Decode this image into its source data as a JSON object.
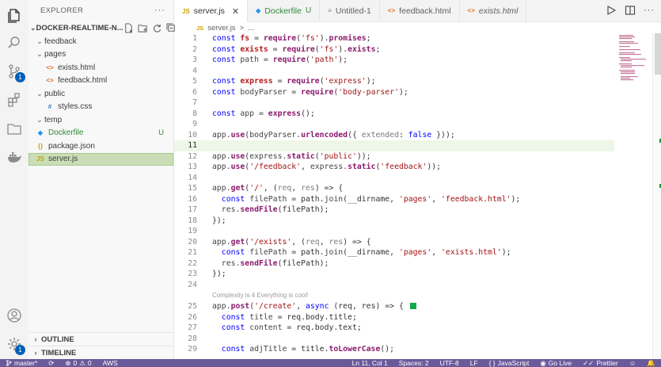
{
  "activity_bar": {
    "icons": [
      "files-icon",
      "search-icon",
      "source-control-icon",
      "extensions-icon",
      "remote-explorer-icon",
      "docker-icon",
      "account-icon",
      "settings-gear-icon"
    ],
    "source_control_badge": "1",
    "settings_badge": "1"
  },
  "sidebar": {
    "title": "EXPLORER",
    "more": "···",
    "project": "DOCKER-REALTIME-N...",
    "tree": [
      {
        "label": "feedback",
        "type": "folder",
        "depth": 1,
        "open": true
      },
      {
        "label": "pages",
        "type": "folder",
        "depth": 1,
        "open": true
      },
      {
        "label": "exists.html",
        "type": "html",
        "depth": 2
      },
      {
        "label": "feedback.html",
        "type": "html",
        "depth": 2
      },
      {
        "label": "public",
        "type": "folder",
        "depth": 1,
        "open": true
      },
      {
        "label": "styles.css",
        "type": "css",
        "depth": 2
      },
      {
        "label": "temp",
        "type": "folder",
        "depth": 1,
        "open": true
      },
      {
        "label": "Dockerfile",
        "type": "docker",
        "depth": 1,
        "git": "U"
      },
      {
        "label": "package.json",
        "type": "json",
        "depth": 1
      },
      {
        "label": "server.js",
        "type": "js",
        "depth": 1,
        "selected": true
      }
    ],
    "outline": "OUTLINE",
    "timeline": "TIMELINE"
  },
  "tabs": [
    {
      "label": "server.js",
      "icon": "JS",
      "active": true,
      "close": "✕"
    },
    {
      "label": "Dockerfile",
      "icon": "docker",
      "status": "U"
    },
    {
      "label": "Untitled-1",
      "icon": "≡"
    },
    {
      "label": "feedback.html",
      "icon": "<>"
    },
    {
      "label": "exists.html",
      "icon": "<>",
      "italic": true
    }
  ],
  "breadcrumb": {
    "icon": "JS",
    "file": "server.js",
    "sep": ">",
    "rest": "..."
  },
  "editor": {
    "codelens": "Complexity is 4 Everything is cool!",
    "current_line": 11,
    "lines": [
      {
        "n": "1",
        "t": [
          [
            "const ",
            "kw"
          ],
          [
            "fs",
            "var"
          ],
          [
            " = ",
            ""
          ],
          [
            "require",
            "fn"
          ],
          [
            "(",
            ""
          ],
          [
            "'fs'",
            "str"
          ],
          [
            ").",
            ""
          ],
          [
            "promises",
            "fn"
          ],
          [
            ";",
            ""
          ]
        ]
      },
      {
        "n": "2",
        "t": [
          [
            "const ",
            "kw"
          ],
          [
            "exists",
            "var"
          ],
          [
            " = ",
            ""
          ],
          [
            "require",
            "fn"
          ],
          [
            "(",
            ""
          ],
          [
            "'fs'",
            "str"
          ],
          [
            ").",
            ""
          ],
          [
            "exists",
            "fn"
          ],
          [
            ";",
            ""
          ]
        ]
      },
      {
        "n": "3",
        "t": [
          [
            "const ",
            "kw"
          ],
          [
            "path",
            "obj"
          ],
          [
            " = ",
            ""
          ],
          [
            "require",
            "fn"
          ],
          [
            "(",
            ""
          ],
          [
            "'path'",
            "str"
          ],
          [
            ");",
            ""
          ]
        ]
      },
      {
        "n": "4",
        "t": []
      },
      {
        "n": "5",
        "t": [
          [
            "const ",
            "kw"
          ],
          [
            "express",
            "var"
          ],
          [
            " = ",
            ""
          ],
          [
            "require",
            "fn"
          ],
          [
            "(",
            ""
          ],
          [
            "'express'",
            "str"
          ],
          [
            ");",
            ""
          ]
        ]
      },
      {
        "n": "6",
        "t": [
          [
            "const ",
            "kw"
          ],
          [
            "bodyParser",
            "obj"
          ],
          [
            " = ",
            ""
          ],
          [
            "require",
            "fn"
          ],
          [
            "(",
            ""
          ],
          [
            "'body-parser'",
            "str"
          ],
          [
            ");",
            ""
          ]
        ]
      },
      {
        "n": "7",
        "t": []
      },
      {
        "n": "8",
        "t": [
          [
            "const ",
            "kw"
          ],
          [
            "app",
            "obj"
          ],
          [
            " = ",
            ""
          ],
          [
            "express",
            "fn"
          ],
          [
            "();",
            ""
          ]
        ]
      },
      {
        "n": "9",
        "t": []
      },
      {
        "n": "10",
        "t": [
          [
            "app.",
            "obj"
          ],
          [
            "use",
            "fn"
          ],
          [
            "(",
            ""
          ],
          [
            "bodyParser.",
            "obj"
          ],
          [
            "urlencoded",
            "fn"
          ],
          [
            "({ ",
            ""
          ],
          [
            "extended",
            "prm"
          ],
          [
            ": ",
            ""
          ],
          [
            "false",
            "bool"
          ],
          [
            " }));",
            ""
          ]
        ]
      },
      {
        "n": "11",
        "t": []
      },
      {
        "n": "12",
        "t": [
          [
            "app.",
            "obj"
          ],
          [
            "use",
            "fn"
          ],
          [
            "(",
            ""
          ],
          [
            "express.",
            "obj"
          ],
          [
            "static",
            "fn"
          ],
          [
            "(",
            ""
          ],
          [
            "'public'",
            "str"
          ],
          [
            "));",
            ""
          ]
        ]
      },
      {
        "n": "13",
        "t": [
          [
            "app.",
            "obj"
          ],
          [
            "use",
            "fn"
          ],
          [
            "(",
            ""
          ],
          [
            "'/feedback'",
            "str"
          ],
          [
            ", ",
            ""
          ],
          [
            "express.",
            "obj"
          ],
          [
            "static",
            "fn"
          ],
          [
            "(",
            ""
          ],
          [
            "'feedback'",
            "str"
          ],
          [
            "));",
            ""
          ]
        ]
      },
      {
        "n": "14",
        "t": []
      },
      {
        "n": "15",
        "t": [
          [
            "app.",
            "obj"
          ],
          [
            "get",
            "fn"
          ],
          [
            "(",
            ""
          ],
          [
            "'/'",
            "str"
          ],
          [
            ", (",
            ""
          ],
          [
            "req",
            "prm"
          ],
          [
            ", ",
            ""
          ],
          [
            "res",
            "prm"
          ],
          [
            ") => {",
            ""
          ]
        ]
      },
      {
        "n": "16",
        "t": [
          [
            "  const ",
            "kw"
          ],
          [
            "filePath",
            "obj"
          ],
          [
            " = path.",
            ""
          ],
          [
            "join",
            "obj"
          ],
          [
            "(__dirname, ",
            ""
          ],
          [
            "'pages'",
            "str"
          ],
          [
            ", ",
            ""
          ],
          [
            "'feedback.html'",
            "str"
          ],
          [
            ");",
            ""
          ]
        ]
      },
      {
        "n": "17",
        "t": [
          [
            "  res.",
            "obj"
          ],
          [
            "sendFile",
            "fn"
          ],
          [
            "(filePath);",
            ""
          ]
        ]
      },
      {
        "n": "18",
        "t": [
          [
            "});",
            ""
          ]
        ]
      },
      {
        "n": "19",
        "t": []
      },
      {
        "n": "20",
        "t": [
          [
            "app.",
            "obj"
          ],
          [
            "get",
            "fn"
          ],
          [
            "(",
            ""
          ],
          [
            "'/exists'",
            "str"
          ],
          [
            ", (",
            ""
          ],
          [
            "req",
            "prm"
          ],
          [
            ", ",
            ""
          ],
          [
            "res",
            "prm"
          ],
          [
            ") => {",
            ""
          ]
        ]
      },
      {
        "n": "21",
        "t": [
          [
            "  const ",
            "kw"
          ],
          [
            "filePath",
            "obj"
          ],
          [
            " = path.",
            ""
          ],
          [
            "join",
            "obj"
          ],
          [
            "(__dirname, ",
            ""
          ],
          [
            "'pages'",
            "str"
          ],
          [
            ", ",
            ""
          ],
          [
            "'exists.html'",
            "str"
          ],
          [
            ");",
            ""
          ]
        ]
      },
      {
        "n": "22",
        "t": [
          [
            "  res.",
            "obj"
          ],
          [
            "sendFile",
            "fn"
          ],
          [
            "(filePath);",
            ""
          ]
        ]
      },
      {
        "n": "23",
        "t": [
          [
            "});",
            ""
          ]
        ]
      },
      {
        "n": "24",
        "t": []
      },
      {
        "n": "25",
        "t": [
          [
            "app.",
            "obj"
          ],
          [
            "post",
            "fn"
          ],
          [
            "(",
            ""
          ],
          [
            "'/create'",
            "str"
          ],
          [
            ", ",
            ""
          ],
          [
            "async",
            "kw"
          ],
          [
            " (req, res) => { ",
            ""
          ]
        ],
        "swatch": true
      },
      {
        "n": "26",
        "t": [
          [
            "  const ",
            "kw"
          ],
          [
            "title",
            "obj"
          ],
          [
            " = req.body.title;",
            ""
          ]
        ]
      },
      {
        "n": "27",
        "t": [
          [
            "  const ",
            "kw"
          ],
          [
            "content",
            "obj"
          ],
          [
            " = req.body.text;",
            ""
          ]
        ]
      },
      {
        "n": "28",
        "t": []
      },
      {
        "n": "29",
        "t": [
          [
            "  const ",
            "kw"
          ],
          [
            "adjTitle",
            "obj"
          ],
          [
            " = title.",
            ""
          ],
          [
            "toLowerCase",
            "fn"
          ],
          [
            "();",
            ""
          ]
        ]
      }
    ]
  },
  "statusbar": {
    "branch": "master*",
    "errors": "0",
    "warnings": "0",
    "aws": "AWS",
    "position": "Ln 11, Col 1",
    "spaces": "Spaces: 2",
    "encoding": "UTF-8",
    "eol": "LF",
    "language": "JavaScript",
    "golive": "Go Live",
    "prettier": "Prettier"
  },
  "colors": {
    "statusbar": "#6a5a9a",
    "selection": "#c9deb7",
    "git_untracked": "#2f8a3a"
  }
}
